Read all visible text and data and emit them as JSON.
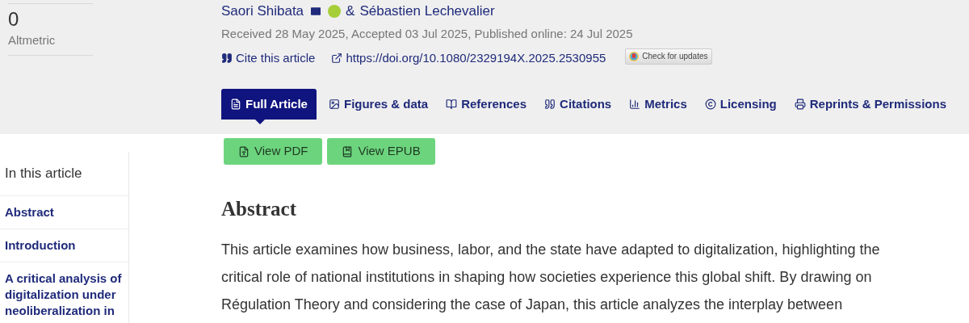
{
  "metric": {
    "value": "0",
    "label": "Altmetric"
  },
  "authors": [
    {
      "name": "Saori Shibata",
      "email": true,
      "orcid": true
    },
    {
      "name": "Sébastien Lechevalier",
      "email": false,
      "orcid": false
    }
  ],
  "author_separator": "&",
  "dates": "Received 28 May 2025, Accepted 03 Jul 2025, Published online: 24 Jul 2025",
  "cite_link": "Cite this article",
  "doi_link": "https://doi.org/10.1080/2329194X.2025.2530955",
  "updates_button": "Check for updates",
  "tabs": [
    {
      "label": "Full Article",
      "selected": true
    },
    {
      "label": "Figures & data",
      "selected": false
    },
    {
      "label": "References",
      "selected": false
    },
    {
      "label": "Citations",
      "selected": false
    },
    {
      "label": "Metrics",
      "selected": false
    },
    {
      "label": "Licensing",
      "selected": false
    },
    {
      "label": "Reprints & Permissions",
      "selected": false
    }
  ],
  "download_buttons": [
    "View PDF",
    "View EPUB"
  ],
  "sidebar": {
    "title": "In this article",
    "items": [
      "Abstract",
      "Introduction",
      "A critical analysis of digitalization under neoliberalization in"
    ]
  },
  "abstract": {
    "heading": "Abstract",
    "lines": [
      "This article examines how business, labor, and the state have adapted to digitalization, highlighting the",
      "critical role of national institutions in shaping how societies experience this global shift. By drawing on",
      "Régulation Theory and considering the case of Japan, this article analyzes the interplay between"
    ]
  }
}
